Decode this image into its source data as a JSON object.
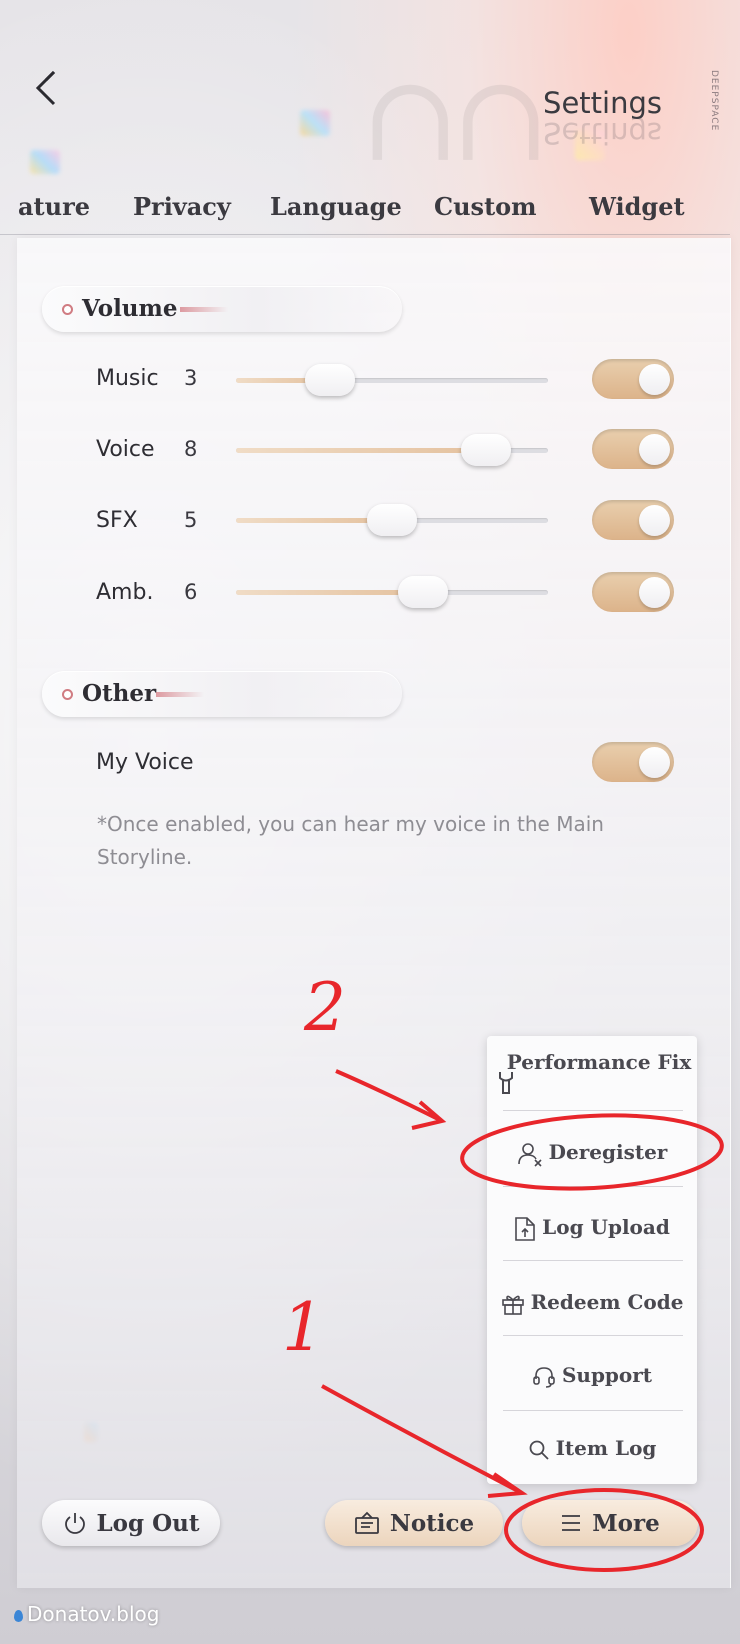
{
  "header": {
    "title": "Settings",
    "brand_vertical": "DEEPSPACE"
  },
  "tabs": [
    {
      "label": "ature"
    },
    {
      "label": "Privacy"
    },
    {
      "label": "Language"
    },
    {
      "label": "Custom"
    },
    {
      "label": "Widget"
    }
  ],
  "volume": {
    "section_title": "Volume",
    "rows": [
      {
        "label": "Music",
        "value": "3",
        "level": 0.3,
        "enabled": true
      },
      {
        "label": "Voice",
        "value": "8",
        "level": 0.8,
        "enabled": true
      },
      {
        "label": "SFX",
        "value": "5",
        "level": 0.5,
        "enabled": true
      },
      {
        "label": "Amb.",
        "value": "6",
        "level": 0.6,
        "enabled": true
      }
    ]
  },
  "other": {
    "section_title": "Other",
    "my_voice_label": "My Voice",
    "my_voice_enabled": true,
    "note": "*Once enabled, you can hear my voice in the Main Storyline."
  },
  "more_menu": {
    "items": [
      {
        "label": "Performance Fix",
        "icon": "wrench-icon"
      },
      {
        "label": "Deregister",
        "icon": "user-remove-icon"
      },
      {
        "label": "Log Upload",
        "icon": "file-upload-icon"
      },
      {
        "label": "Redeem Code",
        "icon": "gift-icon"
      },
      {
        "label": "Support",
        "icon": "headset-icon"
      },
      {
        "label": "Item Log",
        "icon": "search-icon"
      }
    ]
  },
  "bottom_bar": {
    "logout_label": "Log Out",
    "notice_label": "Notice",
    "more_label": "More"
  },
  "annotations": {
    "step1": "1",
    "step2": "2",
    "color": "#e8262b"
  },
  "footer": {
    "watermark": "Donatov.blog"
  },
  "colors": {
    "toggle_on": "#dcb38a",
    "slider_fill": "#e4c19e",
    "accent_dot": "#d07c82"
  }
}
